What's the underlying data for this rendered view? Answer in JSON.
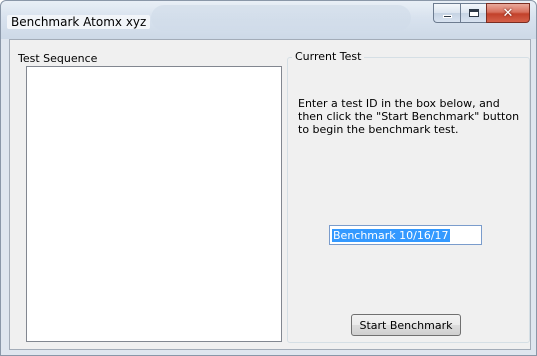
{
  "window": {
    "title": "Benchmark Atomx xyz",
    "caption_buttons": {
      "minimize_icon": "minimize-icon",
      "maximize_icon": "maximize-icon",
      "close_icon": "close-icon",
      "close_glyph": "✕"
    }
  },
  "test_sequence": {
    "label": "Test Sequence",
    "items": []
  },
  "current_test": {
    "label": "Current Test",
    "instructions": "Enter a test ID in the box below, and then click the \"Start Benchmark\" button to begin the benchmark test.",
    "test_id_value": "Benchmark 10/16/17",
    "start_button_label": "Start Benchmark"
  },
  "colors": {
    "selection": "#3399ff",
    "close_button": "#c2412b"
  }
}
